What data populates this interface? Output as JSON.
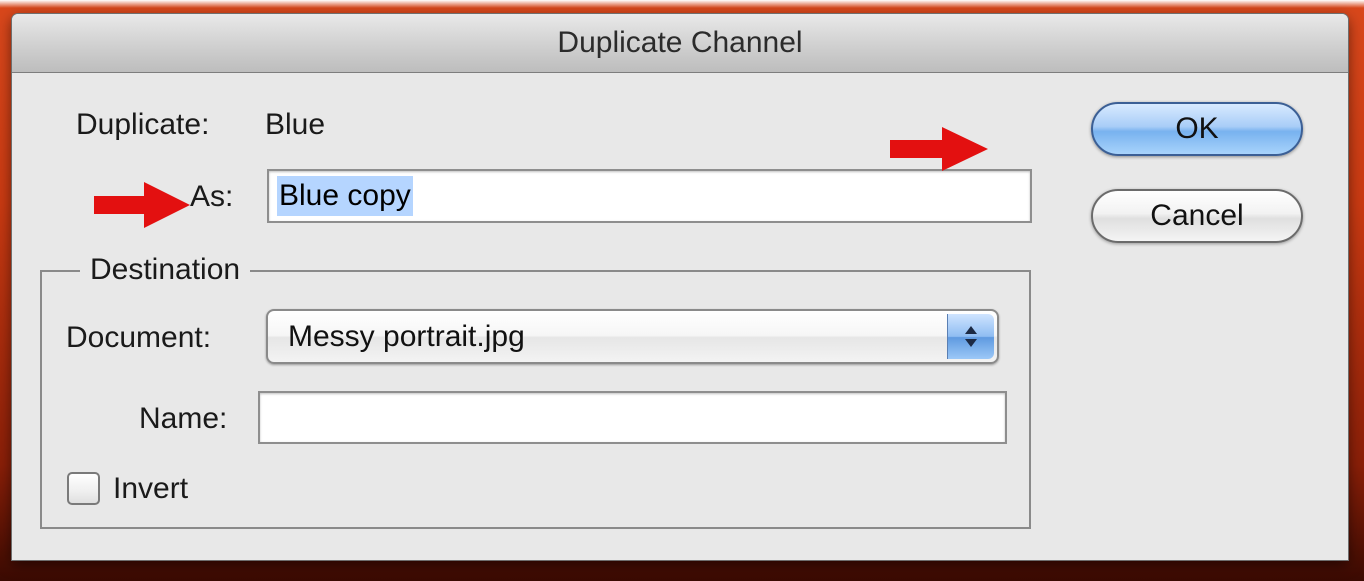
{
  "dialog": {
    "title": "Duplicate Channel"
  },
  "source": {
    "label": "Duplicate:",
    "value": "Blue"
  },
  "as_field": {
    "label": "As:",
    "value": "Blue copy"
  },
  "buttons": {
    "ok": "OK",
    "cancel": "Cancel"
  },
  "destination": {
    "legend": "Destination",
    "document_label": "Document:",
    "document_value": "Messy portrait.jpg",
    "name_label": "Name:",
    "name_value": ""
  },
  "invert": {
    "label": "Invert",
    "checked": false
  },
  "colors": {
    "annotation_arrow": "#e31010",
    "ok_button_blue": "#78b2ef",
    "selection_highlight": "#b5d5ff",
    "background_orange": "#c93a12"
  },
  "icons": {
    "arrows": [
      "red-arrow-icon",
      "red-arrow-icon"
    ],
    "popup_stepper": "up-down-chevrons-icon"
  }
}
